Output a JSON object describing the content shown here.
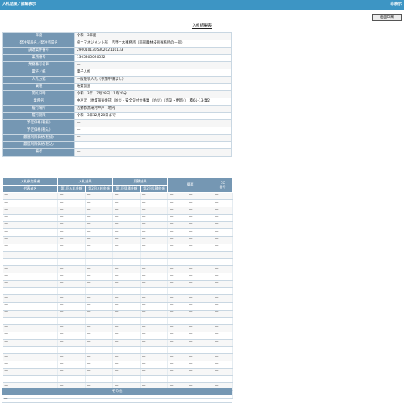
{
  "header": {
    "title": "入札結果／詳細表示",
    "close_label": "非表示"
  },
  "toolbar": {
    "print_label": "画面印刷"
  },
  "section_title": "入札結果表",
  "info": [
    {
      "label": "年度",
      "value": "令和　3年度"
    },
    {
      "label": "発注部局名／発注所属名",
      "value": "県土マネジメント部　吉野土木事務所（南部農林技術事務所の一部）"
    },
    {
      "label": "調達案件番号",
      "value": "290010130530202110133"
    },
    {
      "label": "業務番号",
      "value": "1305305020532"
    },
    {
      "label": "業務番号名称",
      "value": "―"
    },
    {
      "label": "電子／紙",
      "value": "電子入札"
    },
    {
      "label": "入札方式",
      "value": "一般競争入札（参加申請なし）"
    },
    {
      "label": "業種",
      "value": "地質調査"
    },
    {
      "label": "開札日時",
      "value": "令和　3年　7月28日 11時20分"
    },
    {
      "label": "業務名",
      "value": "中戸沢　地質調査委託（防災・安全交付金事業（防災）（新設・更新））　積61-13-業2"
    },
    {
      "label": "履行場所",
      "value": "吉野郡黒滝村中戸　地内"
    },
    {
      "label": "履行期限",
      "value": "令和　3年12月28日まで"
    },
    {
      "label": "予定価格(税抜)",
      "value": "―"
    },
    {
      "label": "予定価格(税込)",
      "value": "―"
    },
    {
      "label": "最低制限価格(税抜)",
      "value": "―"
    },
    {
      "label": "最低制限価格(税込)",
      "value": "―"
    },
    {
      "label": "備考",
      "value": "―"
    }
  ],
  "bid_table": {
    "headers": {
      "participant": "入札参加業者",
      "company": "代表者名",
      "bid_result": "入札結果",
      "bid1": "第1回入札金額",
      "bid2": "第2回入札金額",
      "quote": "見積結果",
      "quote1": "第1回見積金額",
      "quote2": "第2回見積金額",
      "summary": "摘要",
      "cc": "CC",
      "cc2": "番号"
    },
    "rows": [
      [
        "―",
        "―",
        "―",
        "―",
        "―",
        "―",
        "―",
        "―"
      ],
      [
        "―",
        "―",
        "―",
        "―",
        "―",
        "―",
        "―",
        "―"
      ],
      [
        "―",
        "―",
        "―",
        "―",
        "―",
        "―",
        "―",
        "―"
      ],
      [
        "―",
        "―",
        "―",
        "―",
        "―",
        "―",
        "―",
        "―"
      ],
      [
        "―",
        "―",
        "―",
        "―",
        "―",
        "―",
        "―",
        "―"
      ],
      [
        "―",
        "―",
        "―",
        "―",
        "―",
        "―",
        "―",
        "―"
      ],
      [
        "―",
        "―",
        "―",
        "―",
        "―",
        "―",
        "―",
        "―"
      ],
      [
        "―",
        "―",
        "―",
        "―",
        "―",
        "―",
        "―",
        "―"
      ],
      [
        "―",
        "―",
        "―",
        "―",
        "―",
        "―",
        "―",
        "―"
      ],
      [
        "―",
        "―",
        "―",
        "―",
        "―",
        "―",
        "―",
        "―"
      ],
      [
        "―",
        "―",
        "―",
        "―",
        "―",
        "―",
        "―",
        "―"
      ],
      [
        "―",
        "―",
        "―",
        "―",
        "―",
        "―",
        "―",
        "―"
      ],
      [
        "―",
        "―",
        "―",
        "―",
        "―",
        "―",
        "―",
        "―"
      ],
      [
        "―",
        "―",
        "―",
        "―",
        "―",
        "―",
        "―",
        "―"
      ],
      [
        "―",
        "―",
        "―",
        "―",
        "―",
        "―",
        "―",
        "―"
      ],
      [
        "―",
        "―",
        "―",
        "―",
        "―",
        "―",
        "―",
        "―"
      ],
      [
        "―",
        "―",
        "―",
        "―",
        "―",
        "―",
        "―",
        "―"
      ],
      [
        "―",
        "―",
        "―",
        "―",
        "―",
        "―",
        "―",
        "―"
      ],
      [
        "―",
        "―",
        "―",
        "―",
        "―",
        "―",
        "―",
        "―"
      ],
      [
        "―",
        "―",
        "―",
        "―",
        "―",
        "―",
        "―",
        "―"
      ],
      [
        "―",
        "―",
        "―",
        "―",
        "―",
        "―",
        "―",
        "―"
      ],
      [
        "―",
        "―",
        "―",
        "―",
        "―",
        "―",
        "―",
        "―"
      ],
      [
        "―",
        "―",
        "―",
        "―",
        "―",
        "―",
        "―",
        "―"
      ],
      [
        "―",
        "―",
        "―",
        "―",
        "―",
        "―",
        "―",
        "―"
      ],
      [
        "―",
        "―",
        "―",
        "―",
        "―",
        "―",
        "―",
        "―"
      ],
      [
        "―",
        "―",
        "―",
        "―",
        "―",
        "―",
        "―",
        "―"
      ],
      [
        "―",
        "―",
        "―",
        "―",
        "―",
        "―",
        "―",
        "―"
      ]
    ],
    "last_row": "―"
  },
  "other": {
    "title": "その他",
    "value": "―"
  },
  "colors": {
    "titlebar": "#3d95c4",
    "header_cell": "#7597b3"
  }
}
